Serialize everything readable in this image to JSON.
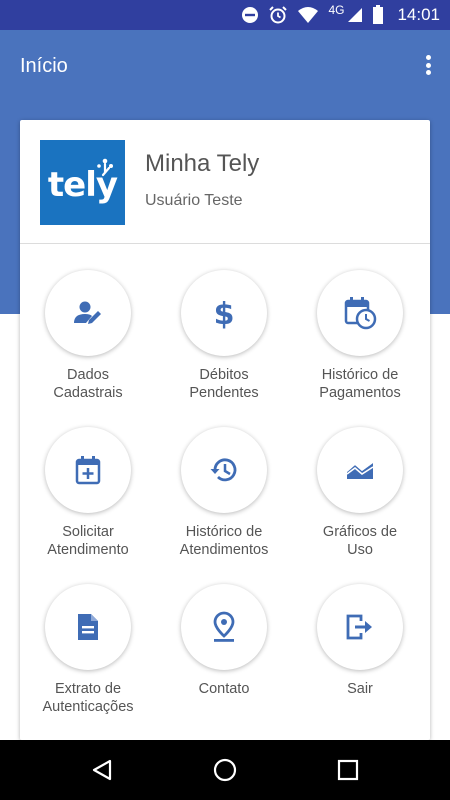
{
  "status_bar": {
    "network": "4G",
    "time": "14:01"
  },
  "app_bar": {
    "title": "Início"
  },
  "account": {
    "logo_text": "tely",
    "name": "Minha Tely",
    "user": "Usuário Teste"
  },
  "menu": {
    "items": [
      {
        "label": "Dados\nCadastrais",
        "icon": "person-edit-icon"
      },
      {
        "label": "Débitos\nPendentes",
        "icon": "dollar-icon"
      },
      {
        "label": "Histórico de\nPagamentos",
        "icon": "calendar-clock-icon"
      },
      {
        "label": "Solicitar\nAtendimento",
        "icon": "calendar-plus-icon"
      },
      {
        "label": "Histórico de\nAtendimentos",
        "icon": "history-icon"
      },
      {
        "label": "Gráficos de\nUso",
        "icon": "area-chart-icon"
      },
      {
        "label": "Extrato de\nAutenticações",
        "icon": "document-icon"
      },
      {
        "label": "Contato",
        "icon": "location-pin-icon"
      },
      {
        "label": "Sair",
        "icon": "logout-icon"
      }
    ]
  },
  "colors": {
    "status_bar": "#303f9f",
    "app_bar": "#4a73bd",
    "icon": "#3f6cb5",
    "logo_bg": "#1a73c0"
  }
}
